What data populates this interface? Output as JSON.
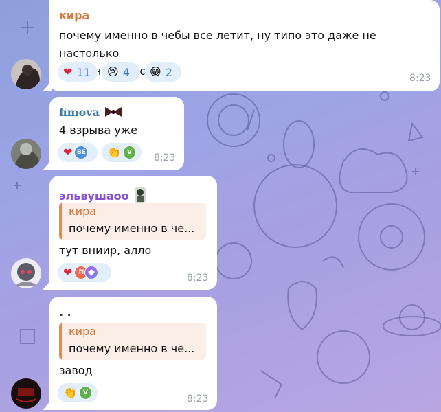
{
  "messages": [
    {
      "sender": "кира",
      "sender_color": "#d97a3a",
      "text_line1": "почему именно в чебы все летит, ну типо это даже не настолько",
      "text_line2": "знаменитый город",
      "time": "8:23",
      "reactions": [
        {
          "emoji": "❤",
          "count": "11"
        },
        {
          "emoji": "😢",
          "count": "4"
        },
        {
          "emoji": "😁",
          "count": "2"
        }
      ]
    },
    {
      "sender": "fimova",
      "sender_color": "#3e7ea6",
      "sender_badge": "bow-icon",
      "text": "4 взрыва уже",
      "time": "8:23",
      "reactions": [
        {
          "emoji": "❤",
          "avatars": [
            "BE"
          ]
        },
        {
          "emoji": "👏",
          "avatars": [
            "V"
          ]
        }
      ]
    },
    {
      "sender": "эльвушаоо",
      "sender_color": "#8a4fd3",
      "reply_name": "кира",
      "reply_text": "почему именно в че...",
      "text": "тут вниир, алло",
      "time": "8:23",
      "reactions": [
        {
          "emoji": "❤",
          "avatars": [
            "П",
            ""
          ]
        }
      ]
    },
    {
      "sender": ". .",
      "reply_name": "кира",
      "reply_text": "почему именно в че...",
      "text": "завод",
      "time": "8:23",
      "reactions": [
        {
          "emoji": "👏",
          "avatars": [
            "V"
          ]
        }
      ]
    }
  ]
}
